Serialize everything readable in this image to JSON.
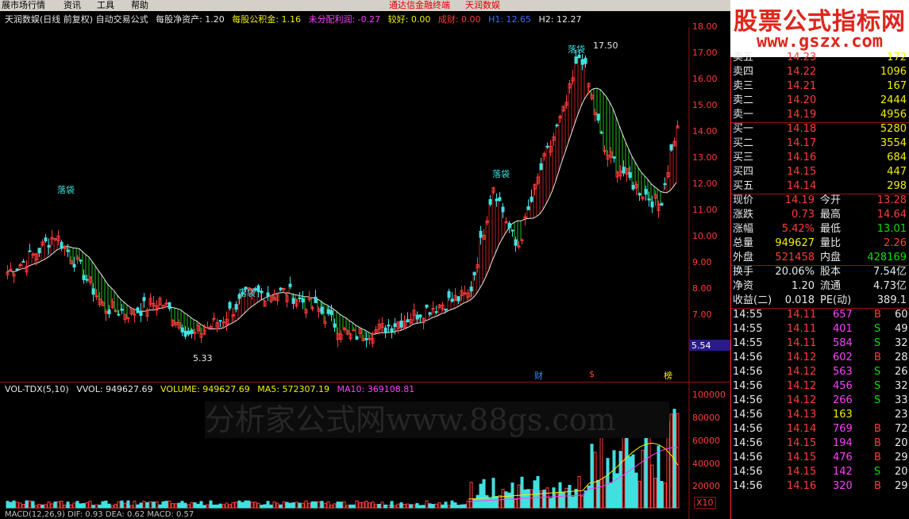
{
  "menu": {
    "items": [
      "展市场行情",
      "资讯",
      "工具",
      "帮助"
    ],
    "notice": [
      "通达信金融终端",
      "天润数娱"
    ]
  },
  "chart_title": {
    "name": "天润数娱(日线 前复权) 自动交易公式",
    "net_asset_label": "每股净资产: 1.20",
    "fund_label": "每股公积金: 1.16",
    "undistributed_label": "未分配利润: -0.27",
    "rating_label": "较好: 0.00",
    "cost_label": "成财: 0.00",
    "h1_label": "H1: 12.65",
    "h2_label": "H2: 12.27"
  },
  "watermark": {
    "line1": "股票公式指标网",
    "line2": "www.gszx.com"
  },
  "price_axis": [
    "18.00",
    "17.00",
    "16.00",
    "15.00",
    "14.00",
    "13.00",
    "12.00",
    "11.00",
    "10.00",
    "9.00",
    "8.00",
    "7.00"
  ],
  "current_price_tag": "5.54",
  "annotations": {
    "high": "17.50",
    "low": "5.33",
    "drop_labels": [
      "落袋",
      "落袋",
      "落袋",
      "落袋"
    ],
    "event_cai": "财",
    "event_dollar": "$",
    "event_bang": "榜"
  },
  "volume": {
    "legend": {
      "name": "VOL-TDX(5,10)",
      "vvol": "VVOL: 949627.69",
      "volume": "VOLUME: 949627.69",
      "ma5": "MA5: 572307.19",
      "ma10": "MA10: 369108.81"
    },
    "axis": [
      "100000",
      "80000",
      "60000",
      "40000",
      "20000"
    ],
    "unit": "X10",
    "watermark": "分析家公式网www.88gs.com"
  },
  "bottom_legend": "MACD(12,26,9) DIF: 0.93  DEA: 0.62  MACD: 0.57",
  "quote": {
    "asks": [
      {
        "label": "卖五",
        "price": "14.23",
        "vol": "172"
      },
      {
        "label": "卖四",
        "price": "14.22",
        "vol": "1096"
      },
      {
        "label": "卖三",
        "price": "14.21",
        "vol": "167"
      },
      {
        "label": "卖二",
        "price": "14.20",
        "vol": "2444"
      },
      {
        "label": "卖一",
        "price": "14.19",
        "vol": "4956"
      }
    ],
    "bids": [
      {
        "label": "买一",
        "price": "14.18",
        "vol": "5280"
      },
      {
        "label": "买二",
        "price": "14.17",
        "vol": "3554"
      },
      {
        "label": "买三",
        "price": "14.16",
        "vol": "684"
      },
      {
        "label": "买四",
        "price": "14.15",
        "vol": "447"
      },
      {
        "label": "买五",
        "price": "14.14",
        "vol": "298"
      }
    ],
    "stats": [
      {
        "l1": "现价",
        "v1": "14.19",
        "l2": "今开",
        "v2": "13.28"
      },
      {
        "l1": "涨跌",
        "v1": "0.73",
        "l2": "最高",
        "v2": "14.64"
      },
      {
        "l1": "涨幅",
        "v1": "5.42%",
        "l2": "最低",
        "v2": "13.01"
      },
      {
        "l1": "总量",
        "v1": "949627",
        "l2": "量比",
        "v2": "2.26"
      },
      {
        "l1": "外盘",
        "v1": "521458",
        "l2": "内盘",
        "v2": "428169"
      }
    ],
    "fund": [
      {
        "l1": "换手",
        "v1": "20.06%",
        "l2": "股本",
        "v2": "7.54亿"
      },
      {
        "l1": "净资",
        "v1": "1.20",
        "l2": "流通",
        "v2": "4.73亿"
      },
      {
        "l1": "收益(二)",
        "v1": "0.018",
        "l2": "PE(动)",
        "v2": "389.1"
      }
    ],
    "ticks": [
      {
        "t": "14:55",
        "p": "14.11",
        "v": "657",
        "bs": "B",
        "n": "60"
      },
      {
        "t": "14:55",
        "p": "14.11",
        "v": "401",
        "bs": "S",
        "n": "49"
      },
      {
        "t": "14:55",
        "p": "14.11",
        "v": "584",
        "bs": "S",
        "n": "32"
      },
      {
        "t": "14:56",
        "p": "14.12",
        "v": "602",
        "bs": "B",
        "n": "28"
      },
      {
        "t": "14:56",
        "p": "14.12",
        "v": "563",
        "bs": "S",
        "n": "26"
      },
      {
        "t": "14:56",
        "p": "14.12",
        "v": "456",
        "bs": "S",
        "n": "32"
      },
      {
        "t": "14:56",
        "p": "14.12",
        "v": "266",
        "bs": "S",
        "n": "33"
      },
      {
        "t": "14:56",
        "p": "14.13",
        "v": "163",
        "bs": "",
        "n": "23"
      },
      {
        "t": "14:56",
        "p": "14.14",
        "v": "769",
        "bs": "B",
        "n": "72"
      },
      {
        "t": "14:56",
        "p": "14.15",
        "v": "194",
        "bs": "B",
        "n": "20"
      },
      {
        "t": "14:56",
        "p": "14.15",
        "v": "476",
        "bs": "B",
        "n": "29"
      },
      {
        "t": "14:56",
        "p": "14.15",
        "v": "142",
        "bs": "S",
        "n": "20"
      },
      {
        "t": "14:56",
        "p": "14.16",
        "v": "320",
        "bs": "B",
        "n": "29"
      }
    ]
  },
  "colors": {
    "up": "#ff3c3c",
    "down": "#40e0e0",
    "yellow": "#f0f000",
    "magenta": "#ff40ff",
    "green": "#00e000"
  }
}
